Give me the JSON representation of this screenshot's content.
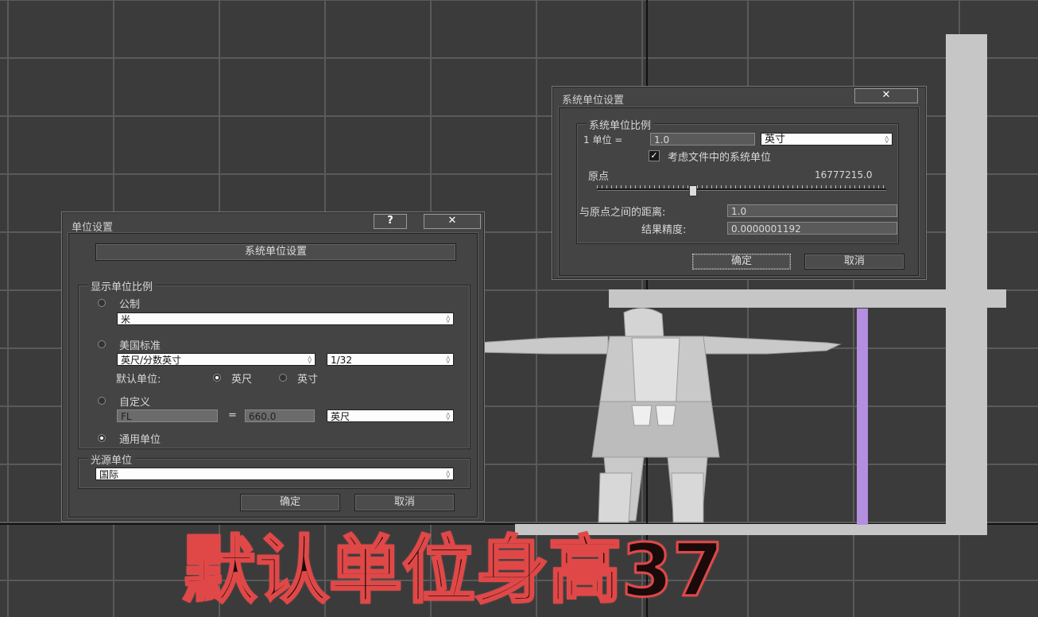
{
  "unit_setup": {
    "title": "单位设置",
    "help_label": "?",
    "close_label": "✕",
    "system_unit_button": "系统单位设置",
    "display_scale_label": "显示单位比例",
    "metric_label": "公制",
    "metric_value": "米",
    "us_standard_label": "美国标准",
    "us_unit_value": "英尺/分数英寸",
    "us_fraction_value": "1/32",
    "default_unit_label": "默认单位:",
    "feet_label": "英尺",
    "inch_label": "英寸",
    "custom_label": "自定义",
    "custom_name": "FL",
    "equals": "=",
    "custom_value": "660.0",
    "custom_unit": "英尺",
    "generic_label": "通用单位",
    "lighting_label": "光源单位",
    "lighting_value": "国际",
    "ok_label": "确定",
    "cancel_label": "取消",
    "selected_display": "generic"
  },
  "system_unit_setup": {
    "title": "系统单位设置",
    "close_label": "✕",
    "scale_group_label": "系统单位比例",
    "one_unit_label": "1 单位 =",
    "scale_value": "1.0",
    "scale_unit": "英寸",
    "respect_file_label": "考虑文件中的系统单位",
    "respect_file_checked": true,
    "origin_label": "原点",
    "origin_value": "16777215.0",
    "origin_slider_fraction": 0.33,
    "distance_label": "与原点之间的距离:",
    "distance_value": "1.0",
    "precision_label": "结果精度:",
    "precision_value": "0.0000001192",
    "ok_label": "确定",
    "cancel_label": "取消"
  },
  "caption": {
    "text": "默认单位身高37",
    "stroke_color": "#e04848"
  },
  "colors": {
    "viewport_bg": "#3b3b3b",
    "grid": "#5a5a5a",
    "measure_bar": "#b48fe0",
    "scene_geometry": "#c6c6c6"
  }
}
